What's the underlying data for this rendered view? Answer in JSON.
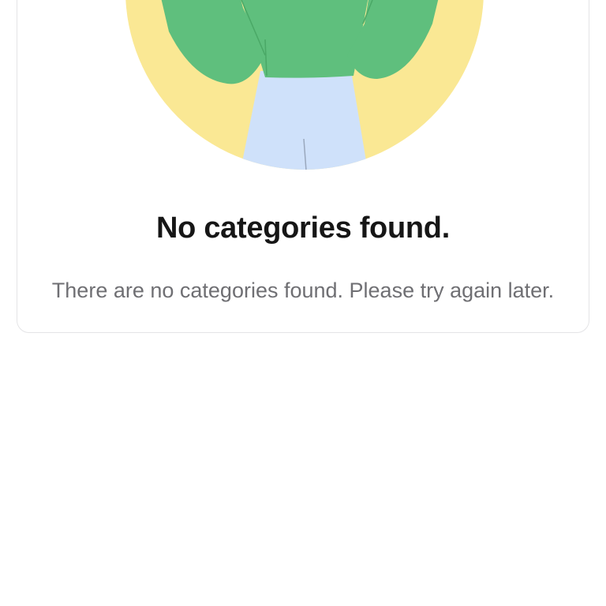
{
  "empty_state": {
    "illustration_icon": "person-in-circle-illustration",
    "title": "No categories found.",
    "message": "There are no categories found. Please try again later."
  },
  "colors": {
    "circle_background": "#fae894",
    "sweater": "#5fbf7d",
    "pants": "#cfe1fa",
    "title_text": "#161616",
    "message_text": "#6f6f73",
    "card_border": "#e4e4e6"
  }
}
